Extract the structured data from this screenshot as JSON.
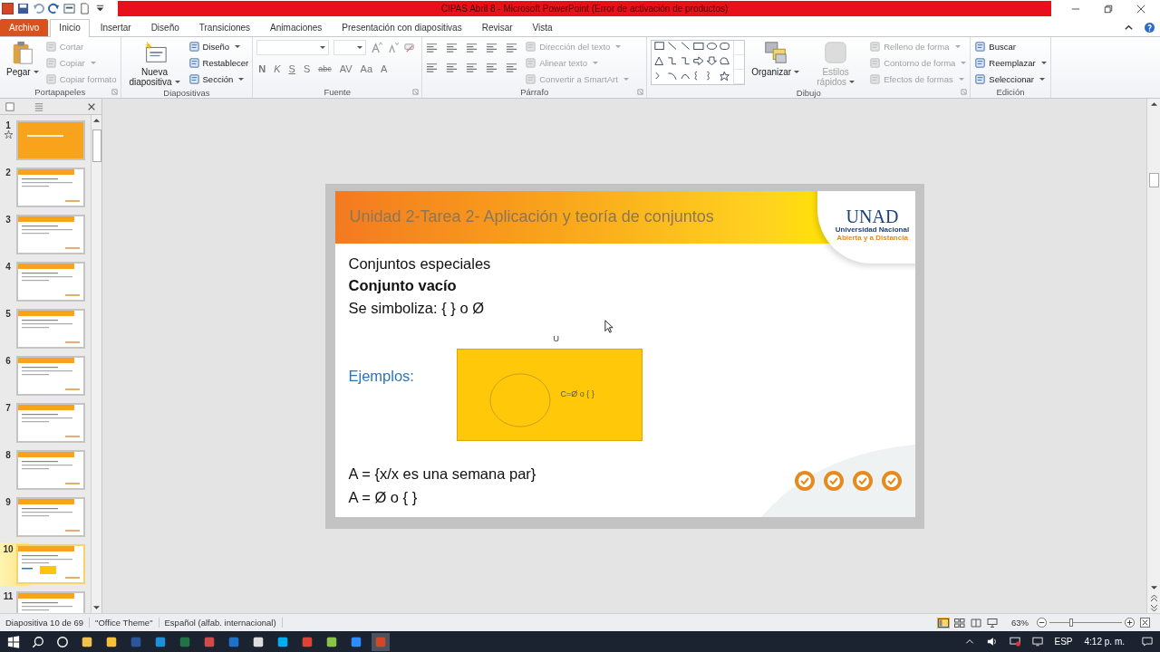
{
  "window": {
    "title": "CIPAS  Abril 8  -  Microsoft PowerPoint (Error de activación de productos)"
  },
  "tabs": [
    {
      "label": "Archivo",
      "kind": "file",
      "selected": false
    },
    {
      "label": "Inicio",
      "kind": "tab",
      "selected": true
    },
    {
      "label": "Insertar",
      "kind": "tab",
      "selected": false
    },
    {
      "label": "Diseño",
      "kind": "tab",
      "selected": false
    },
    {
      "label": "Transiciones",
      "kind": "tab",
      "selected": false
    },
    {
      "label": "Animaciones",
      "kind": "tab",
      "selected": false
    },
    {
      "label": "Presentación con diapositivas",
      "kind": "tab",
      "selected": false
    },
    {
      "label": "Revisar",
      "kind": "tab",
      "selected": false
    },
    {
      "label": "Vista",
      "kind": "tab",
      "selected": false
    }
  ],
  "ribbon": [
    {
      "label": "Portapapeles",
      "kind": "clipboard",
      "large": [
        {
          "label": "Pegar",
          "disabled": false,
          "menu": true
        }
      ],
      "small": [
        {
          "label": "Cortar",
          "disabled": true,
          "menu": false
        },
        {
          "label": "Copiar",
          "disabled": true,
          "menu": true
        },
        {
          "label": "Copiar formato",
          "disabled": true,
          "menu": false
        }
      ]
    },
    {
      "label": "Diapositivas",
      "kind": "slides",
      "large": [
        {
          "label": "Nueva diapositiva",
          "disabled": false,
          "menu": true
        }
      ],
      "small": [
        {
          "label": "Diseño",
          "disabled": false,
          "menu": true
        },
        {
          "label": "Restablecer",
          "disabled": false,
          "menu": false
        },
        {
          "label": "Sección",
          "disabled": false,
          "menu": true
        }
      ]
    },
    {
      "label": "Fuente",
      "kind": "font",
      "format_buttons": [
        "N",
        "K",
        "S",
        "S",
        "abc",
        "AV",
        "Aa",
        "A"
      ]
    },
    {
      "label": "Párrafo",
      "kind": "paragraph",
      "small": [
        {
          "label": "Dirección del texto",
          "disabled": true,
          "menu": true
        },
        {
          "label": "Alinear texto",
          "disabled": true,
          "menu": true
        },
        {
          "label": "Convertir a SmartArt",
          "disabled": true,
          "menu": true
        }
      ]
    },
    {
      "label": "Dibujo",
      "kind": "drawing",
      "large": [
        {
          "label": "Organizar",
          "disabled": false,
          "menu": true
        },
        {
          "label": "Estilos rápidos",
          "disabled": true,
          "menu": true
        }
      ],
      "small": [
        {
          "label": "Relleno de forma",
          "disabled": true,
          "menu": true
        },
        {
          "label": "Contorno de forma",
          "disabled": true,
          "menu": true
        },
        {
          "label": "Efectos de formas",
          "disabled": true,
          "menu": true
        }
      ]
    },
    {
      "label": "Edición",
      "kind": "editing",
      "small": [
        {
          "label": "Buscar",
          "disabled": false,
          "menu": false
        },
        {
          "label": "Reemplazar",
          "disabled": false,
          "menu": true
        },
        {
          "label": "Seleccionar",
          "disabled": false,
          "menu": true
        }
      ]
    }
  ],
  "thumbnails": [
    {
      "number": "1",
      "kind": "title",
      "selected": false
    },
    {
      "number": "2",
      "kind": "content",
      "selected": false
    },
    {
      "number": "3",
      "kind": "content",
      "selected": false
    },
    {
      "number": "4",
      "kind": "content",
      "selected": false
    },
    {
      "number": "5",
      "kind": "content",
      "selected": false
    },
    {
      "number": "6",
      "kind": "content",
      "selected": false
    },
    {
      "number": "7",
      "kind": "content",
      "selected": false
    },
    {
      "number": "8",
      "kind": "content",
      "selected": false
    },
    {
      "number": "9",
      "kind": "content",
      "selected": false
    },
    {
      "number": "10",
      "kind": "venn",
      "selected": true
    },
    {
      "number": "11",
      "kind": "content",
      "selected": false
    }
  ],
  "slide": {
    "title": "Unidad 2-Tarea 2- Aplicación y teoría de conjuntos",
    "logo": {
      "name": "UNAD",
      "line1": "Universidad Nacional",
      "line2": "Abierta y a Distancia"
    },
    "heading": "Conjuntos especiales",
    "subheading": "Conjunto vacío",
    "symbol_line": "Se simboliza:  { } o Ø",
    "examples_label": "Ejemplos:",
    "venn": {
      "universe_label": "U",
      "set_label": "C=Ø o { }"
    },
    "example_lines": [
      "A = {x/x es una semana par}",
      "A = Ø o {  }"
    ]
  },
  "status_bar": {
    "slide": "Diapositiva 10 de 69",
    "theme": "\"Office Theme\"",
    "language": "Español (alfab. internacional)",
    "zoom": "63%",
    "zoom_slider": {
      "level": 0.3
    }
  },
  "taskbar": {
    "language": "ESP",
    "time": "4:12 p. m."
  }
}
